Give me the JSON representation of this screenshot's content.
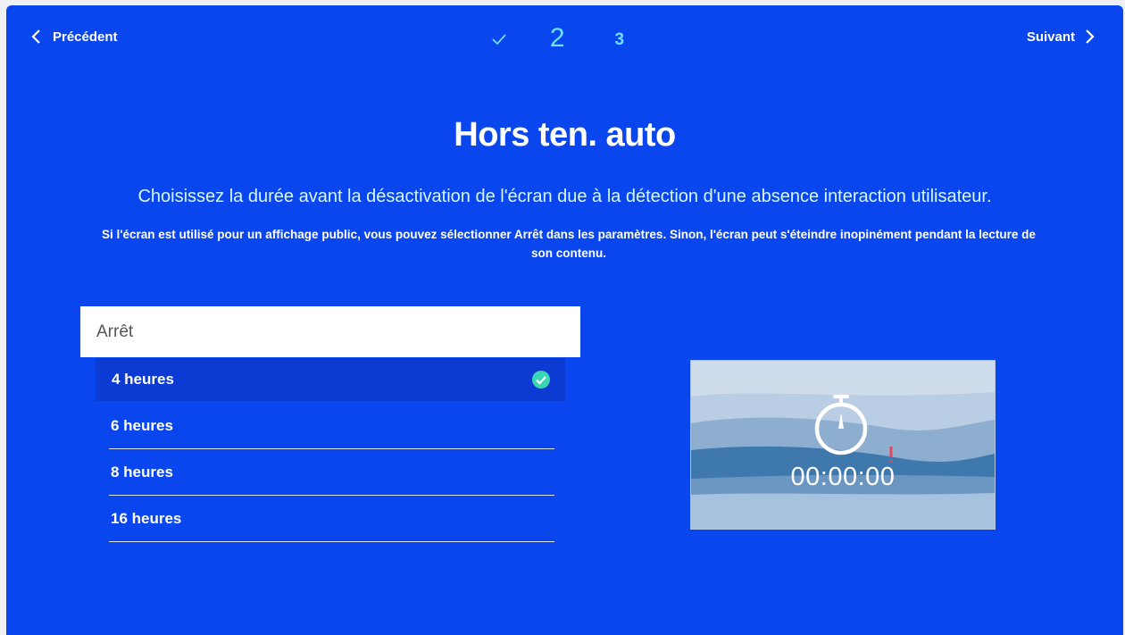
{
  "nav": {
    "prev_label": "Précédent",
    "next_label": "Suivant"
  },
  "steps": {
    "current": "2",
    "next": "3"
  },
  "title": "Hors ten. auto",
  "subtitle": "Choisissez la durée avant la désactivation de l'écran due à la détection d'une absence interaction utilisateur.",
  "note": "Si l'écran est utilisé pour un affichage public, vous pouvez sélectionner Arrêt dans les paramètres. Sinon, l'écran peut s'éteindre inopinément pendant la lecture de son contenu.",
  "dropdown": {
    "label": "Arrêt"
  },
  "options": [
    {
      "label": "4 heures",
      "selected": true
    },
    {
      "label": "6 heures"
    },
    {
      "label": "8 heures"
    },
    {
      "label": "16 heures"
    }
  ],
  "preview": {
    "timer": "00:00:00"
  },
  "colors": {
    "background": "#0a46ee",
    "selected_row": "#0c3bd4",
    "accent": "#6fe0ff",
    "check": "#3ad6b4"
  }
}
